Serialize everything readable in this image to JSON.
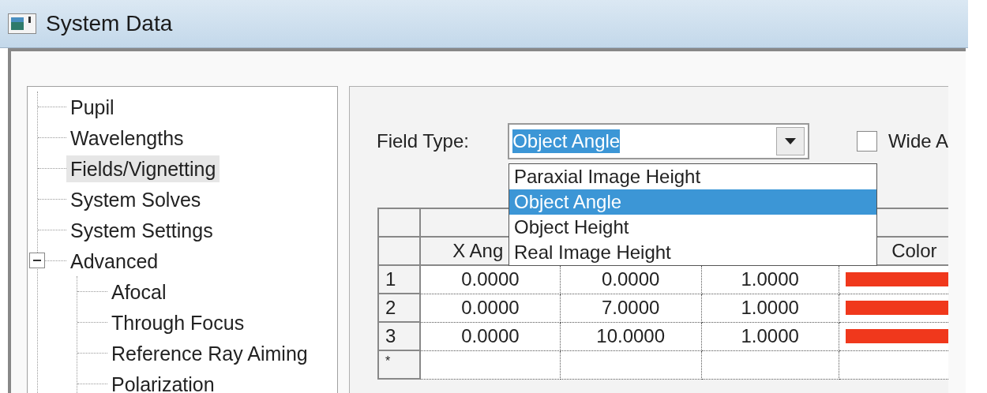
{
  "window": {
    "title": "System Data"
  },
  "tree": {
    "items": [
      {
        "label": "Pupil",
        "selected": false
      },
      {
        "label": "Wavelengths",
        "selected": false
      },
      {
        "label": "Fields/Vignetting",
        "selected": true
      },
      {
        "label": "System Solves",
        "selected": false
      },
      {
        "label": "System Settings",
        "selected": false
      },
      {
        "label": "Advanced",
        "selected": false,
        "expanded": true,
        "children": [
          {
            "label": "Afocal",
            "selected": false
          },
          {
            "label": "Through Focus",
            "selected": false
          },
          {
            "label": "Reference Ray Aiming",
            "selected": false
          },
          {
            "label": "Polarization",
            "selected": false
          }
        ]
      }
    ]
  },
  "field_type": {
    "label": "Field Type:",
    "value": "Object Angle",
    "open": true,
    "options": [
      {
        "label": "Paraxial Image Height",
        "selected": false
      },
      {
        "label": "Object Angle",
        "selected": true
      },
      {
        "label": "Object Height",
        "selected": false
      },
      {
        "label": "Real Image Height",
        "selected": false
      }
    ]
  },
  "wide_angle": {
    "label": "Wide A",
    "checked": false
  },
  "grid": {
    "columns": [
      {
        "label": "X Ang"
      },
      {},
      {},
      {
        "label": "Color"
      }
    ],
    "rows": [
      {
        "number": "1",
        "cells": [
          "0.0000",
          "0.0000",
          "1.0000"
        ],
        "color": "#f0381c"
      },
      {
        "number": "2",
        "cells": [
          "0.0000",
          "7.0000",
          "1.0000"
        ],
        "color": "#f0381c"
      },
      {
        "number": "3",
        "cells": [
          "0.0000",
          "10.0000",
          "1.0000"
        ],
        "color": "#f0381c"
      }
    ],
    "new_row_marker": "*"
  }
}
